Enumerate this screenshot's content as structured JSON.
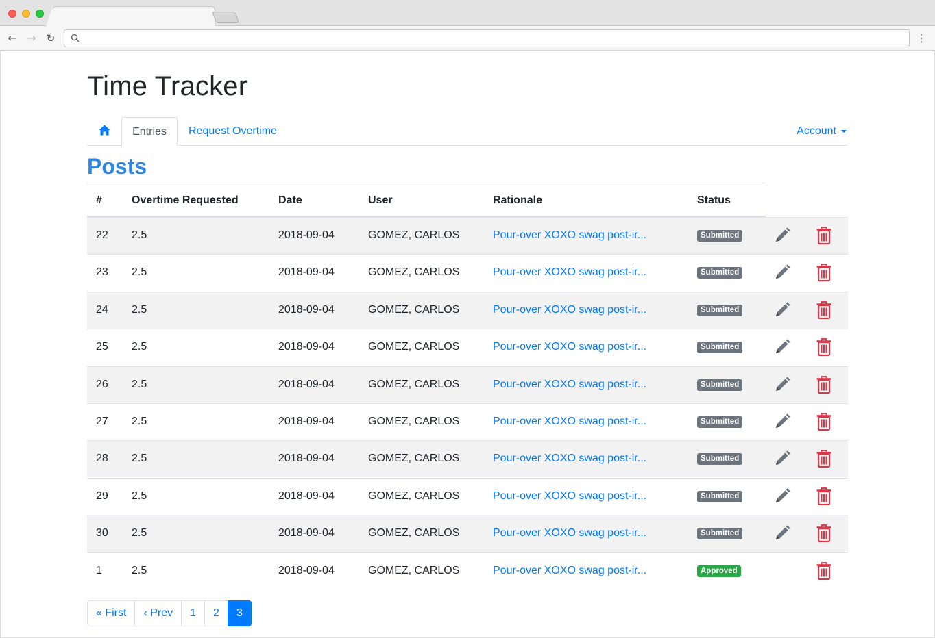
{
  "browser": {
    "tab_title": "",
    "address": ""
  },
  "app": {
    "title": "Time Tracker"
  },
  "nav": {
    "home_icon": "home-icon",
    "tabs": [
      {
        "label": "Entries",
        "active": true
      },
      {
        "label": "Request Overtime",
        "active": false
      }
    ],
    "account_label": "Account"
  },
  "section": {
    "title": "Posts"
  },
  "table": {
    "headers": [
      "#",
      "Overtime Requested",
      "Date",
      "User",
      "Rationale",
      "Status"
    ],
    "rows": [
      {
        "id": "22",
        "overtime": "2.5",
        "date": "2018-09-04",
        "user": "GOMEZ, CARLOS",
        "rationale": "Pour-over XOXO swag post-ir...",
        "status": "Submitted",
        "editable": true
      },
      {
        "id": "23",
        "overtime": "2.5",
        "date": "2018-09-04",
        "user": "GOMEZ, CARLOS",
        "rationale": "Pour-over XOXO swag post-ir...",
        "status": "Submitted",
        "editable": true
      },
      {
        "id": "24",
        "overtime": "2.5",
        "date": "2018-09-04",
        "user": "GOMEZ, CARLOS",
        "rationale": "Pour-over XOXO swag post-ir...",
        "status": "Submitted",
        "editable": true
      },
      {
        "id": "25",
        "overtime": "2.5",
        "date": "2018-09-04",
        "user": "GOMEZ, CARLOS",
        "rationale": "Pour-over XOXO swag post-ir...",
        "status": "Submitted",
        "editable": true
      },
      {
        "id": "26",
        "overtime": "2.5",
        "date": "2018-09-04",
        "user": "GOMEZ, CARLOS",
        "rationale": "Pour-over XOXO swag post-ir...",
        "status": "Submitted",
        "editable": true
      },
      {
        "id": "27",
        "overtime": "2.5",
        "date": "2018-09-04",
        "user": "GOMEZ, CARLOS",
        "rationale": "Pour-over XOXO swag post-ir...",
        "status": "Submitted",
        "editable": true
      },
      {
        "id": "28",
        "overtime": "2.5",
        "date": "2018-09-04",
        "user": "GOMEZ, CARLOS",
        "rationale": "Pour-over XOXO swag post-ir...",
        "status": "Submitted",
        "editable": true
      },
      {
        "id": "29",
        "overtime": "2.5",
        "date": "2018-09-04",
        "user": "GOMEZ, CARLOS",
        "rationale": "Pour-over XOXO swag post-ir...",
        "status": "Submitted",
        "editable": true
      },
      {
        "id": "30",
        "overtime": "2.5",
        "date": "2018-09-04",
        "user": "GOMEZ, CARLOS",
        "rationale": "Pour-over XOXO swag post-ir...",
        "status": "Submitted",
        "editable": true
      },
      {
        "id": "1",
        "overtime": "2.5",
        "date": "2018-09-04",
        "user": "GOMEZ, CARLOS",
        "rationale": "Pour-over XOXO swag post-ir...",
        "status": "Approved",
        "editable": false
      }
    ]
  },
  "pagination": {
    "items": [
      {
        "label": "« First",
        "active": false
      },
      {
        "label": "‹ Prev",
        "active": false
      },
      {
        "label": "1",
        "active": false
      },
      {
        "label": "2",
        "active": false
      },
      {
        "label": "3",
        "active": true
      }
    ]
  },
  "colors": {
    "link": "#007bff",
    "title": "#2d86e4",
    "submitted": "#6c757d",
    "approved": "#28a745",
    "delete": "#dc3545",
    "edit": "#6c757d"
  }
}
